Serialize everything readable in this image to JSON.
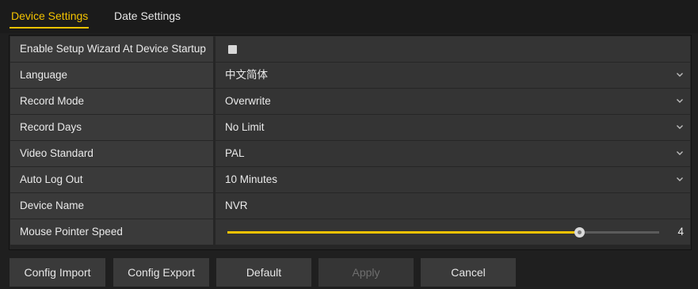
{
  "tabs": {
    "device_settings": "Device Settings",
    "date_settings": "Date Settings"
  },
  "rows": {
    "setup_wizard": {
      "label": "Enable Setup Wizard At Device Startup",
      "checked": false
    },
    "language": {
      "label": "Language",
      "value": "中文简体"
    },
    "record_mode": {
      "label": "Record Mode",
      "value": "Overwrite"
    },
    "record_days": {
      "label": "Record Days",
      "value": "No Limit"
    },
    "video_standard": {
      "label": "Video Standard",
      "value": "PAL"
    },
    "auto_log_out": {
      "label": "Auto Log Out",
      "value": "10 Minutes"
    },
    "device_name": {
      "label": "Device Name",
      "value": "NVR"
    },
    "mouse_pointer_speed": {
      "label": "Mouse Pointer Speed",
      "value": "4",
      "level_fraction": 0.815
    }
  },
  "buttons": {
    "config_import": "Config Import",
    "config_export": "Config Export",
    "default": "Default",
    "apply": "Apply",
    "cancel": "Cancel"
  },
  "colors": {
    "accent": "#f2c200",
    "label_bg": "#3a3a3a",
    "value_bg": "#343434",
    "panel_bg": "#1f1f1f"
  },
  "icons": {
    "dropdown": "chevron-down-icon",
    "checkbox": "checkbox-unchecked"
  }
}
